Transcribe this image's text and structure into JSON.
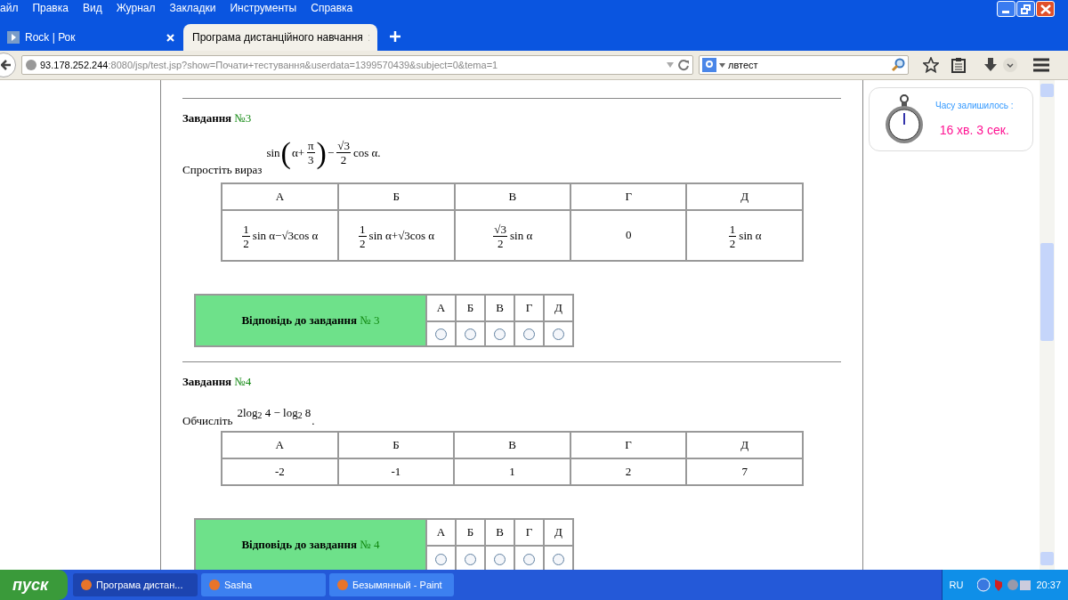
{
  "menu": [
    "айл",
    "Правка",
    "Вид",
    "Журнал",
    "Закладки",
    "Инструменты",
    "Справка"
  ],
  "tabs": [
    {
      "label": "Rock | Рок",
      "selected": false
    },
    {
      "label": "Програма дистанційного навчання",
      "selected": true
    }
  ],
  "address": {
    "host": "93.178.252.244",
    "rest": ":8080/jsp/test.jsp?show=Почати+тестування&userdata=1399570439&subject=0&tema=1"
  },
  "search": {
    "value": "лвтест"
  },
  "tasks": [
    {
      "heading": "Завдання",
      "number": "№3",
      "prompt": "Спростіть вираз",
      "formula": [
        {
          "kind": "text",
          "text": "sin"
        },
        {
          "kind": "big",
          "text": "("
        },
        {
          "kind": "text",
          "text": "α+"
        },
        {
          "kind": "frac",
          "num": "π",
          "den": "3"
        },
        {
          "kind": "big",
          "text": ")"
        },
        {
          "kind": "text",
          "text": "−"
        },
        {
          "kind": "frac",
          "num": "√3",
          "den": "2"
        },
        {
          "kind": "text",
          "text": "cos α."
        }
      ],
      "columns": [
        "А",
        "Б",
        "В",
        "Г",
        "Д"
      ],
      "options": [
        [
          {
            "kind": "frac",
            "num": "1",
            "den": "2"
          },
          {
            "kind": "text",
            "text": "sin α−√3cos α"
          }
        ],
        [
          {
            "kind": "frac",
            "num": "1",
            "den": "2"
          },
          {
            "kind": "text",
            "text": "sin α+√3cos α"
          }
        ],
        [
          {
            "kind": "frac",
            "num": "√3",
            "den": "2"
          },
          {
            "kind": "text",
            "text": "sin α"
          }
        ],
        [
          {
            "kind": "text",
            "text": "0"
          }
        ],
        [
          {
            "kind": "frac",
            "num": "1",
            "den": "2"
          },
          {
            "kind": "text",
            "text": "sin α"
          }
        ]
      ],
      "answer": {
        "label": "Відповідь до завдання",
        "number": "№ 3",
        "choices": [
          {
            "label": "А",
            "selected": false
          },
          {
            "label": "Б",
            "selected": false
          },
          {
            "label": "В",
            "selected": false
          },
          {
            "label": "Г",
            "selected": false
          },
          {
            "label": "Д",
            "selected": false
          }
        ]
      }
    },
    {
      "heading": "Завдання",
      "number": "№4",
      "prompt": "Обчисліть",
      "formula": [
        {
          "kind": "text",
          "text": "2log$_{2}$ 4 − log$_{2}$ 8"
        }
      ],
      "suffix": ".",
      "columns": [
        "А",
        "Б",
        "В",
        "Г",
        "Д"
      ],
      "options": [
        [
          {
            "kind": "text",
            "text": "-2"
          }
        ],
        [
          {
            "kind": "text",
            "text": "-1"
          }
        ],
        [
          {
            "kind": "text",
            "text": "1"
          }
        ],
        [
          {
            "kind": "text",
            "text": "2"
          }
        ],
        [
          {
            "kind": "text",
            "text": "7"
          }
        ]
      ],
      "answer": {
        "label": "Відповідь до завдання",
        "number": "№ 4",
        "choices": [
          {
            "label": "А",
            "selected": false
          },
          {
            "label": "Б",
            "selected": false
          },
          {
            "label": "В",
            "selected": false
          },
          {
            "label": "Г",
            "selected": false
          },
          {
            "label": "Д",
            "selected": false
          }
        ]
      }
    }
  ],
  "timer": {
    "label": "Часу залишилось :",
    "value": "16 хв. 3 сек."
  },
  "taskbar": {
    "start": "пуск",
    "items": [
      {
        "label": "Програма дистан...",
        "selected": true
      },
      {
        "label": "Sasha",
        "selected": false
      },
      {
        "label": "Безымянный - Paint",
        "selected": false
      }
    ],
    "language": "RU",
    "clock": "20:37"
  }
}
